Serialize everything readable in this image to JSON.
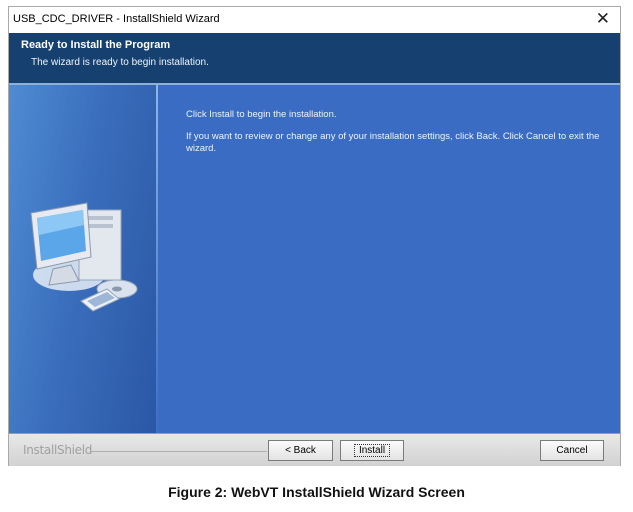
{
  "window": {
    "title": "USB_CDC_DRIVER - InstallShield Wizard"
  },
  "header": {
    "title": "Ready to Install the Program",
    "subtitle": "The wizard is ready to begin installation."
  },
  "content": {
    "line1": "Click Install to begin the installation.",
    "line2": "If you want to review or change any of your installation settings, click Back. Click Cancel to exit the wizard."
  },
  "footer": {
    "brand": "InstallShield",
    "back_label": "< Back",
    "install_label": "Install",
    "cancel_label": "Cancel"
  },
  "caption": "Figure 2: WebVT InstallShield Wizard Screen",
  "icons": {
    "close": "close-icon",
    "computer": "computer-icon",
    "cd": "cd-icon"
  },
  "colors": {
    "header": "#15406f",
    "content": "#3a6cc4",
    "panel": "#4f8bd3"
  }
}
